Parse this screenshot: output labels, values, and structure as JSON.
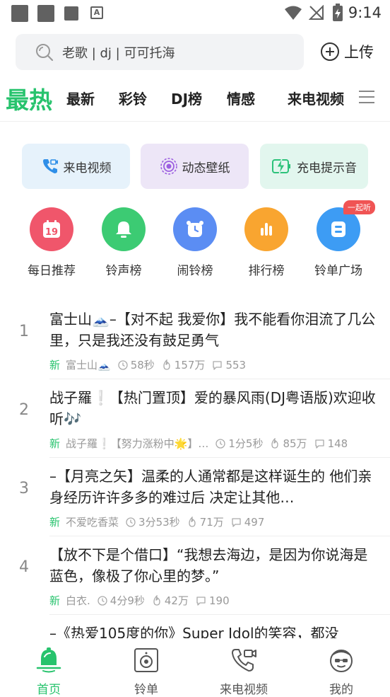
{
  "status_bar": {
    "time": "9:14"
  },
  "search": {
    "placeholder": "老歌 | dj | 可可托海",
    "upload_label": "上传"
  },
  "tabs": [
    "最热",
    "最新",
    "彩铃",
    "DJ榜",
    "情感",
    "来电视频"
  ],
  "features": [
    {
      "label": "来电视频",
      "icon": "phone-video-icon",
      "bg": "#e6f2fb",
      "color": "#2f8fe8"
    },
    {
      "label": "动态壁纸",
      "icon": "live-wallpaper-icon",
      "bg": "#ede6f7",
      "color": "#9c5fe0"
    },
    {
      "label": "充电提示音",
      "icon": "charging-icon",
      "bg": "#e2f6ee",
      "color": "#2cc27a"
    }
  ],
  "categories": [
    {
      "label": "每日推荐",
      "icon": "calendar-icon",
      "value": "19",
      "color": "#f0566b"
    },
    {
      "label": "铃声榜",
      "icon": "bell-icon",
      "color": "#3ccb73"
    },
    {
      "label": "闹铃榜",
      "icon": "alarm-clock-icon",
      "color": "#5b8df3"
    },
    {
      "label": "排行榜",
      "icon": "bar-chart-icon",
      "color": "#f9a530"
    },
    {
      "label": "铃单广场",
      "icon": "playlist-icon",
      "color": "#3d9cf4",
      "badge": "一起听"
    }
  ],
  "songs": [
    {
      "rank": "1",
      "title": "富士山🗻–【对不起 我爱你】我不能看你泪流了几公里，只是我还没有鼓足勇气",
      "tag": "新",
      "author": "富士山🗻",
      "duration": "58秒",
      "heat": "157万",
      "comments": "553"
    },
    {
      "rank": "2",
      "title": "战子羅❕【热门置顶】爱的暴风雨(DJ粤语版)欢迎收听🎶",
      "tag": "新",
      "author": "战子羅❕【努力涨粉中🌟】…",
      "duration": "1分5秒",
      "heat": "85万",
      "comments": "148"
    },
    {
      "rank": "3",
      "title": "–【月亮之矢】温柔的人通常都是这样诞生的 他们亲身经历许许多多的难过后 决定让其他…",
      "tag": "新",
      "author": "不爱吃香菜",
      "duration": "3分53秒",
      "heat": "71万",
      "comments": "497"
    },
    {
      "rank": "4",
      "title": "【放不下是个借口】“我想去海边，是因为你说海是蓝色，像极了你心里的梦。”",
      "tag": "新",
      "author": "白衣.",
      "duration": "4分9秒",
      "heat": "42万",
      "comments": "190"
    },
    {
      "rank": "",
      "title": "–《热爱105度的你》Super Idol的笑容，都没",
      "tag": "",
      "author": "",
      "duration": "",
      "heat": "",
      "comments": ""
    }
  ],
  "bottom_nav": [
    {
      "label": "首页",
      "icon": "home-bell-icon",
      "active": true
    },
    {
      "label": "铃单",
      "icon": "speaker-icon",
      "active": false
    },
    {
      "label": "来电视频",
      "icon": "phone-video-icon",
      "active": false
    },
    {
      "label": "我的",
      "icon": "profile-avatar-icon",
      "active": false
    }
  ],
  "colors": {
    "accent": "#27c36d"
  }
}
